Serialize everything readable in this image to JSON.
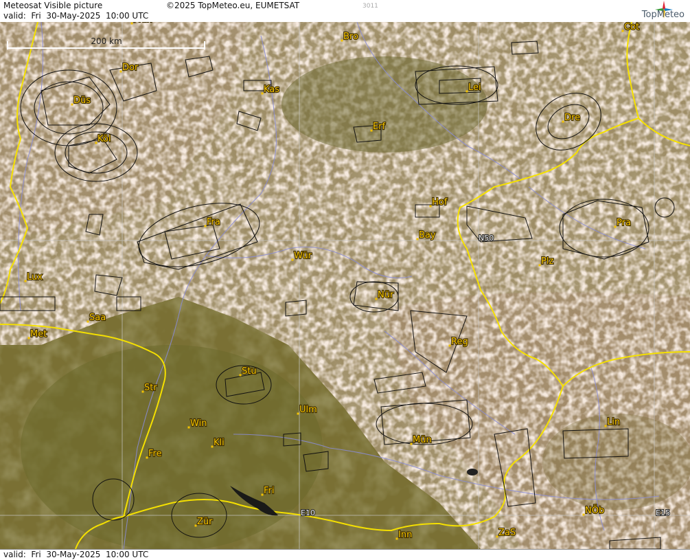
{
  "header": {
    "title": "Meteosat Visible picture",
    "valid": "valid:  Fri  30-May-2025  10:00 UTC",
    "copyright": "©2025 TopMeteo.eu, EUMETSAT",
    "product_code": "3011",
    "logo_text": "TopMeteo"
  },
  "footer": {
    "valid": "valid:  Fri  30-May-2025  10:00 UTC"
  },
  "map": {
    "scale_label": "200 km",
    "grid_labels": [
      "N50",
      "E10",
      "E15"
    ],
    "colors": {
      "border": "#f5e000",
      "airspace": "#111111",
      "rivers": "#8a8cd8",
      "grid": "#bbbbbb",
      "city_label": "#f2c200",
      "forest": "#6e6a2e",
      "cloud": "#e9d2bd"
    },
    "cities": [
      {
        "name": "Mün",
        "id": "munster"
      },
      {
        "name": "Bro"
      },
      {
        "name": "Cot"
      },
      {
        "name": "Dor"
      },
      {
        "name": "Kas"
      },
      {
        "name": "Lei"
      },
      {
        "name": "Düs"
      },
      {
        "name": "Erf"
      },
      {
        "name": "Dre"
      },
      {
        "name": "Köl"
      },
      {
        "name": "Hof"
      },
      {
        "name": "Fra"
      },
      {
        "name": "Bay"
      },
      {
        "name": "Pra"
      },
      {
        "name": "Wür"
      },
      {
        "name": "Plz"
      },
      {
        "name": "Lux"
      },
      {
        "name": "Nür"
      },
      {
        "name": "Saa"
      },
      {
        "name": "Met"
      },
      {
        "name": "Reg"
      },
      {
        "name": "Stu"
      },
      {
        "name": "Str"
      },
      {
        "name": "Ulm"
      },
      {
        "name": "Win"
      },
      {
        "name": "Lin"
      },
      {
        "name": "Kli"
      },
      {
        "name": "Mün",
        "id": "munich"
      },
      {
        "name": "Fre"
      },
      {
        "name": "Fri"
      },
      {
        "name": "NÖb"
      },
      {
        "name": "Zür"
      },
      {
        "name": "Inn"
      },
      {
        "name": "ZaS"
      }
    ]
  }
}
